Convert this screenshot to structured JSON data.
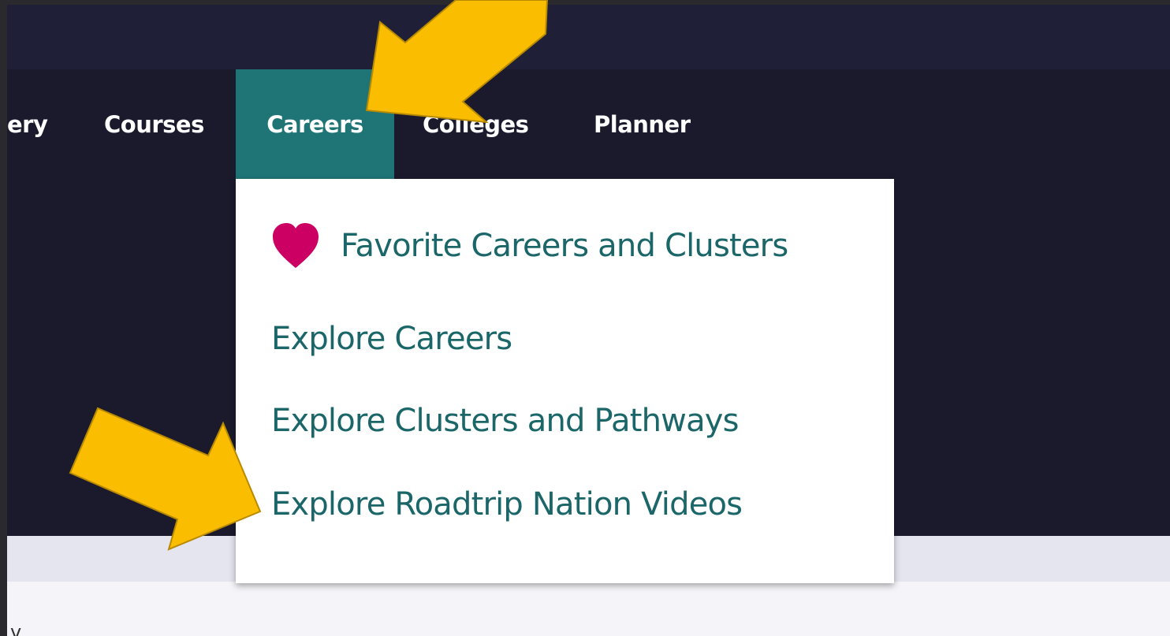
{
  "nav": {
    "items": [
      {
        "label": "ery"
      },
      {
        "label": "Courses"
      },
      {
        "label": "Careers"
      },
      {
        "label": "Colleges"
      },
      {
        "label": "Planner"
      }
    ],
    "active": "Careers"
  },
  "careers_menu": {
    "items": [
      {
        "label": "Favorite Careers and Clusters",
        "icon": "heart-icon"
      },
      {
        "label": "Explore Careers"
      },
      {
        "label": "Explore Clusters and Pathways"
      },
      {
        "label": "Explore Roadtrip Nation Videos"
      }
    ]
  },
  "content": {
    "partial_text": "v"
  },
  "colors": {
    "nav_bg": "#1b1a2c",
    "active_tab": "#1f7576",
    "menu_text": "#1b6668",
    "heart": "#cc0063",
    "arrow": "#fbbd00"
  }
}
